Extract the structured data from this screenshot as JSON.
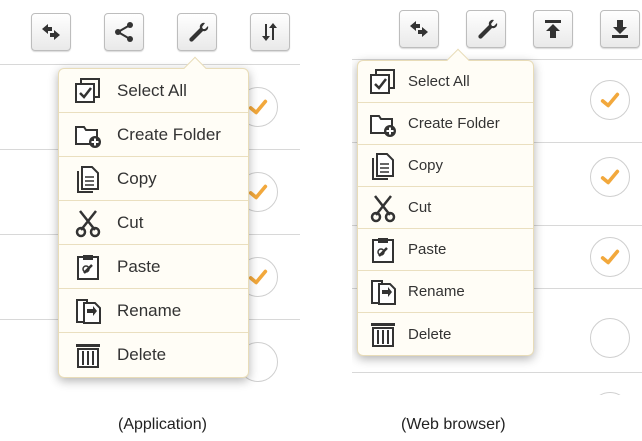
{
  "colors": {
    "check_orange": "#f2a83c",
    "menu_bg": "#fffdf6",
    "menu_border": "#e8dcb8"
  },
  "application": {
    "caption": "(Application)",
    "toolbar": [
      {
        "icon": "back-arrows-icon"
      },
      {
        "icon": "share-icon"
      },
      {
        "icon": "wrench-icon"
      },
      {
        "icon": "sort-icon"
      }
    ],
    "menu": [
      {
        "label": "Select All",
        "icon": "select-all-icon"
      },
      {
        "label": "Create Folder",
        "icon": "create-folder-icon"
      },
      {
        "label": "Copy",
        "icon": "copy-icon"
      },
      {
        "label": "Cut",
        "icon": "scissors-icon"
      },
      {
        "label": "Paste",
        "icon": "paste-icon"
      },
      {
        "label": "Rename",
        "icon": "rename-icon"
      },
      {
        "label": "Delete",
        "icon": "trash-icon"
      }
    ]
  },
  "web_browser": {
    "caption": "(Web browser)",
    "toolbar": [
      {
        "icon": "back-arrows-icon"
      },
      {
        "icon": "wrench-icon"
      },
      {
        "icon": "upload-icon"
      },
      {
        "icon": "download-icon"
      }
    ],
    "menu": [
      {
        "label": "Select All",
        "icon": "select-all-icon"
      },
      {
        "label": "Create Folder",
        "icon": "create-folder-icon"
      },
      {
        "label": "Copy",
        "icon": "copy-icon"
      },
      {
        "label": "Cut",
        "icon": "scissors-icon"
      },
      {
        "label": "Paste",
        "icon": "paste-icon"
      },
      {
        "label": "Rename",
        "icon": "rename-icon"
      },
      {
        "label": "Delete",
        "icon": "trash-icon"
      }
    ]
  }
}
